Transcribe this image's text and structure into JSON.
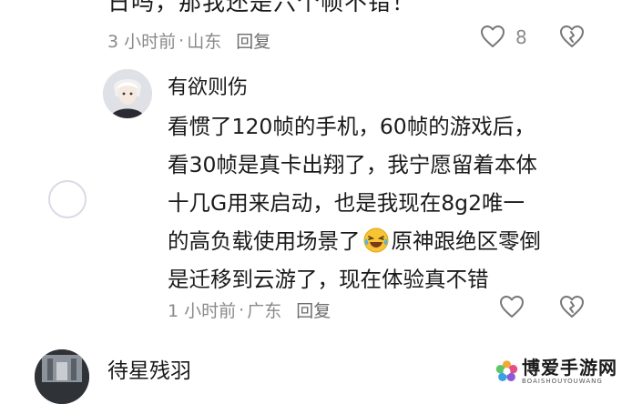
{
  "previous_comment": {
    "text_cut": "日吗，那我还是六个帧不错！",
    "time": "3 小时前",
    "separator": "·",
    "location": "山东",
    "reply_label": "回复",
    "like_count": "8",
    "icons": {
      "like": "heart-outline-icon",
      "dislike": "broken-heart-icon"
    }
  },
  "reply": {
    "username": "有欲则伤",
    "lines": [
      "看惯了120帧的手机，60帧的游戏后，",
      "看30帧是真卡出翔了，我宁愿留着本体",
      "十几G用来启动，也是我现在8g2唯一"
    ],
    "line4_before": "的高负载使用场景了",
    "line4_after": "原神跟绝区零倒",
    "line5": "是迁移到云游了，现在体验真不错",
    "emoji": "laughing-crying-emoji",
    "time": "1 小时前",
    "separator": "·",
    "location": "广东",
    "reply_label": "回复",
    "icons": {
      "like": "heart-outline-icon",
      "dislike": "broken-heart-icon"
    }
  },
  "next_comment": {
    "username": "待星残羽"
  },
  "watermark": {
    "title": "博爱手游网",
    "subtitle": "BOAISHOUYOUWANG"
  },
  "colors": {
    "text": "#1a1a1a",
    "meta": "#8a8a8a",
    "icon": "#777777",
    "placeholder_circle": "#d8dbe6"
  }
}
